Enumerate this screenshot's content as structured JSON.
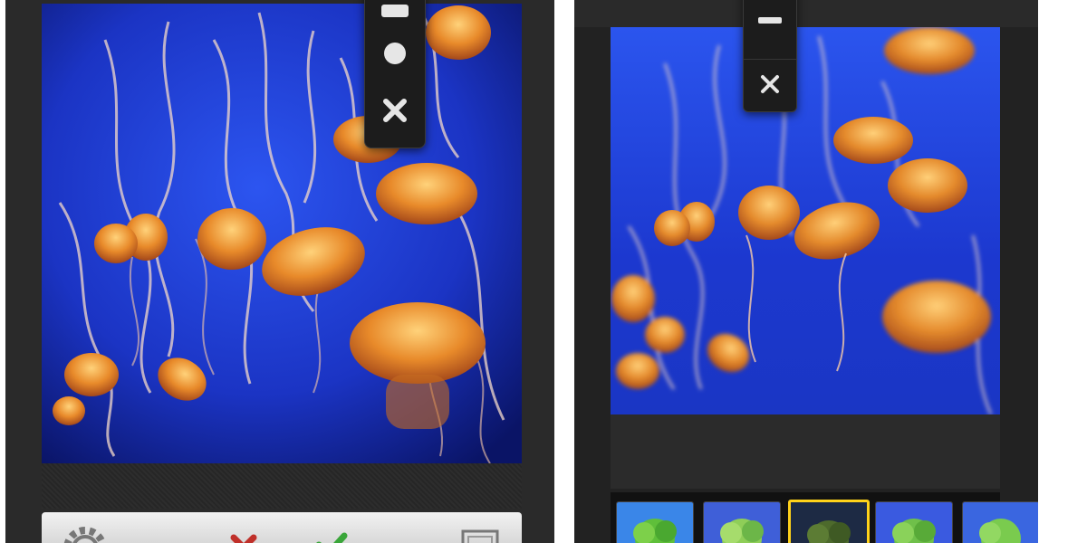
{
  "screens": [
    {
      "id": "left",
      "vignette_options": [
        "linear-icon",
        "radial-icon",
        "off-icon"
      ],
      "toolbar_icons": [
        "settings-icon",
        "cancel-icon",
        "confirm-icon",
        "frame-icon"
      ]
    },
    {
      "id": "right",
      "tiltshift_options": [
        "linear-icon",
        "off-icon"
      ],
      "filter_thumbnails": 5,
      "selected_filter_index": 2
    }
  ],
  "colors": {
    "background": "#ffffff",
    "screen_bg": "#2a2a2a",
    "water_blue": "#1f3fd6",
    "jellyfish_orange": "#e88a2a",
    "selected_filter_border": "#ffd21a",
    "cancel_red": "#c0302a",
    "confirm_green": "#3aa63a"
  }
}
